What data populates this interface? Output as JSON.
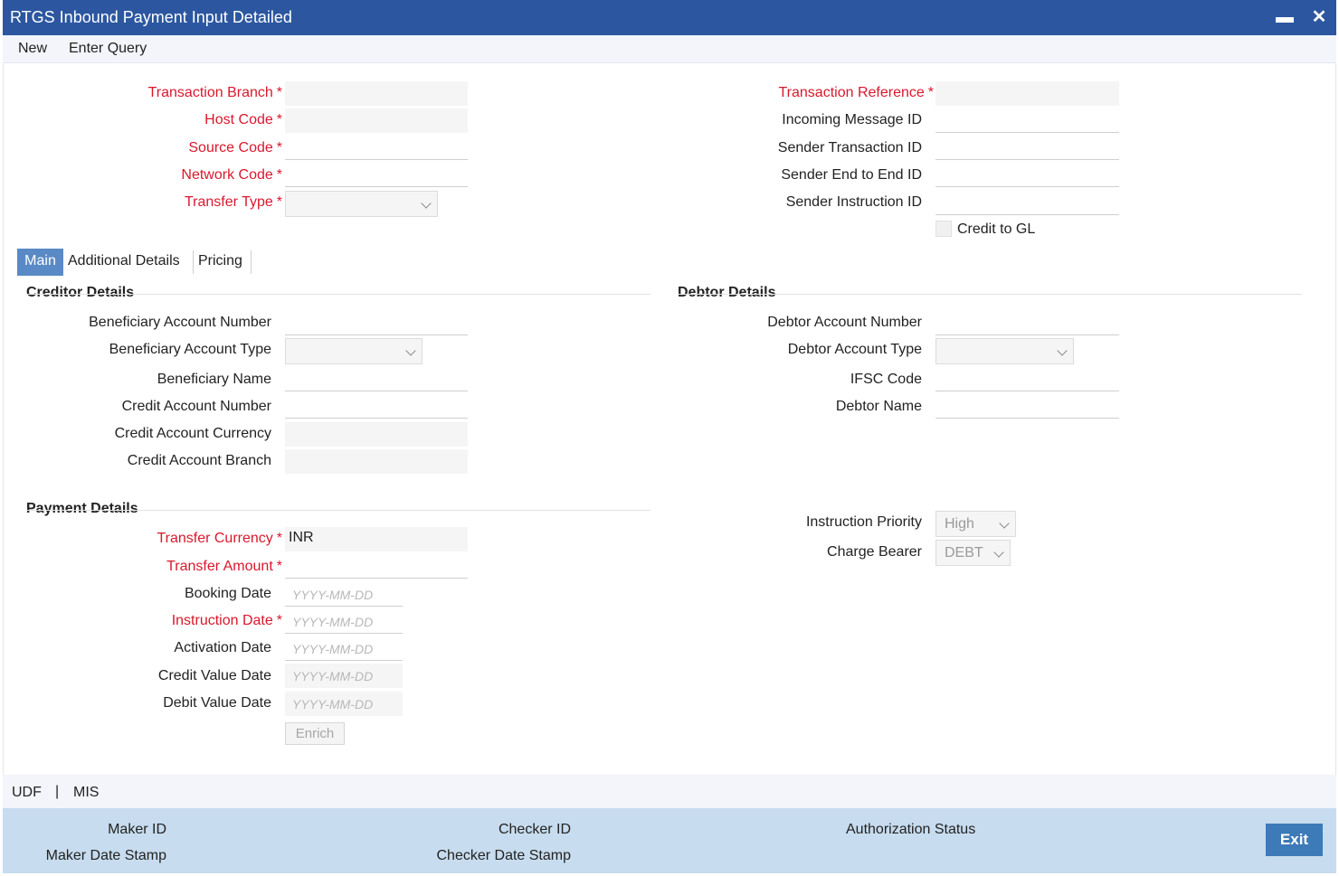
{
  "window": {
    "title": "RTGS Inbound Payment Input Detailed",
    "minimize_glyph": "▬",
    "close_glyph": "✕"
  },
  "menu": {
    "new": "New",
    "enter_query": "Enter Query"
  },
  "header": {
    "transaction_branch": "Transaction Branch",
    "host_code": "Host Code",
    "source_code": "Source Code",
    "network_code": "Network Code",
    "transfer_type": "Transfer Type",
    "transaction_reference": "Transaction Reference",
    "incoming_message_id": "Incoming Message ID",
    "sender_transaction_id": "Sender Transaction ID",
    "sender_end_to_end_id": "Sender End to End ID",
    "sender_instruction_id": "Sender Instruction ID",
    "credit_to_gl": "Credit to GL",
    "required_marker": "*"
  },
  "tabs": [
    "Main",
    "Additional Details",
    "Pricing"
  ],
  "creditor": {
    "title": "Creditor Details",
    "beneficiary_account_number": "Beneficiary Account Number",
    "beneficiary_account_type": "Beneficiary Account Type",
    "beneficiary_name": "Beneficiary Name",
    "credit_account_number": "Credit Account Number",
    "credit_account_currency": "Credit Account Currency",
    "credit_account_branch": "Credit Account Branch"
  },
  "debtor": {
    "title": "Debtor Details",
    "debtor_account_number": "Debtor Account Number",
    "debtor_account_type": "Debtor Account Type",
    "ifsc_code": "IFSC Code",
    "debtor_name": "Debtor Name"
  },
  "payment": {
    "title": "Payment Details",
    "transfer_currency": "Transfer Currency",
    "transfer_currency_value": "INR",
    "transfer_amount": "Transfer Amount",
    "booking_date": "Booking Date",
    "instruction_date": "Instruction Date",
    "activation_date": "Activation Date",
    "credit_value_date": "Credit Value Date",
    "debit_value_date": "Debit Value Date",
    "date_placeholder": "YYYY-MM-DD",
    "enrich": "Enrich",
    "instruction_priority": "Instruction Priority",
    "instruction_priority_value": "High",
    "charge_bearer": "Charge Bearer",
    "charge_bearer_value": "DEBT"
  },
  "bottom_links": {
    "udf": "UDF",
    "separator": "|",
    "mis": "MIS"
  },
  "footer": {
    "maker_id": "Maker ID",
    "maker_date_stamp": "Maker Date Stamp",
    "checker_id": "Checker ID",
    "checker_date_stamp": "Checker Date Stamp",
    "authorization_status": "Authorization Status",
    "exit": "Exit"
  }
}
